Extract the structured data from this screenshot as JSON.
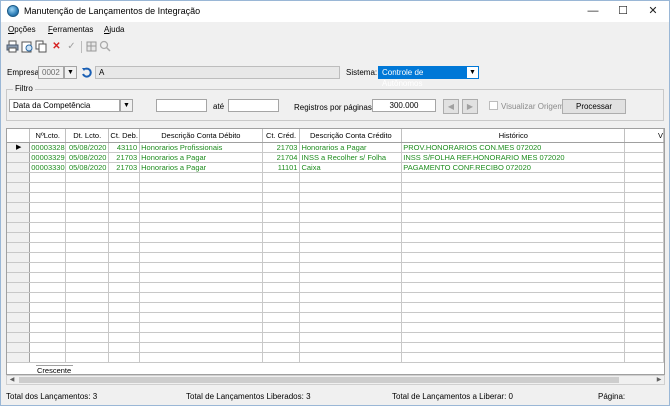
{
  "window": {
    "title": "Manutenção de Lançamentos de Integração",
    "minimize": "—",
    "maximize": "☐",
    "close": "✕"
  },
  "menu": [
    {
      "label": "Opções",
      "accel": "O"
    },
    {
      "label": "Ferramentas",
      "accel": "F"
    },
    {
      "label": "Ajuda",
      "accel": "A"
    }
  ],
  "toolbar": {
    "icons": [
      "printer-icon",
      "print-preview-icon",
      "copy-icon",
      "delete-icon",
      "confirm-icon",
      "grid-icon",
      "search-icon"
    ]
  },
  "empresa": {
    "label": "Empresa:",
    "code": "0002",
    "name": "A"
  },
  "sistema": {
    "label": "Sistema:",
    "value": "Controle de Autônomos"
  },
  "filtro": {
    "legend": "Filtro",
    "date_type": "Data da Competência",
    "from": "",
    "ate_label": "até",
    "to": "",
    "registros_label": "Registros por páginas:",
    "registros_value": "300.000",
    "visualizar_label": "Visualizar Origem",
    "processar_label": "Processar"
  },
  "grid": {
    "columns": [
      "NºLcto.",
      "Dt. Lcto.",
      "Ct. Deb.",
      "Descrição Conta Débito",
      "Ct. Créd.",
      "Descrição Conta Crédito",
      "Histórico",
      "V"
    ],
    "rows": [
      [
        "00003328",
        "05/08/2020",
        "43110",
        "Honorarios Profissionais",
        "21703",
        "Honorarios a Pagar",
        "PROV.HONORARIOS CON.MES 072020"
      ],
      [
        "00003329",
        "05/08/2020",
        "21703",
        "Honorarios a Pagar",
        "21704",
        "INSS a Recolher s/ Folha",
        "INSS S/FOLHA REF.HONORARIO MES 072020"
      ],
      [
        "00003330",
        "05/08/2020",
        "21703",
        "Honorarios a Pagar",
        "11101",
        "Caixa",
        "PAGAMENTO CONF.RECIBO 072020"
      ]
    ],
    "sort_label": "Crescente",
    "row_indicator": "▶"
  },
  "status": {
    "total": "Total dos Lançamentos: 3",
    "liberados": "Total de Lançamentos Liberados: 3",
    "a_liberar": "Total de Lançamentos a Liberar: 0",
    "pagina": "Página:"
  },
  "colors": {
    "row_text": "#1e8c1e",
    "selection": "#0078d7"
  }
}
